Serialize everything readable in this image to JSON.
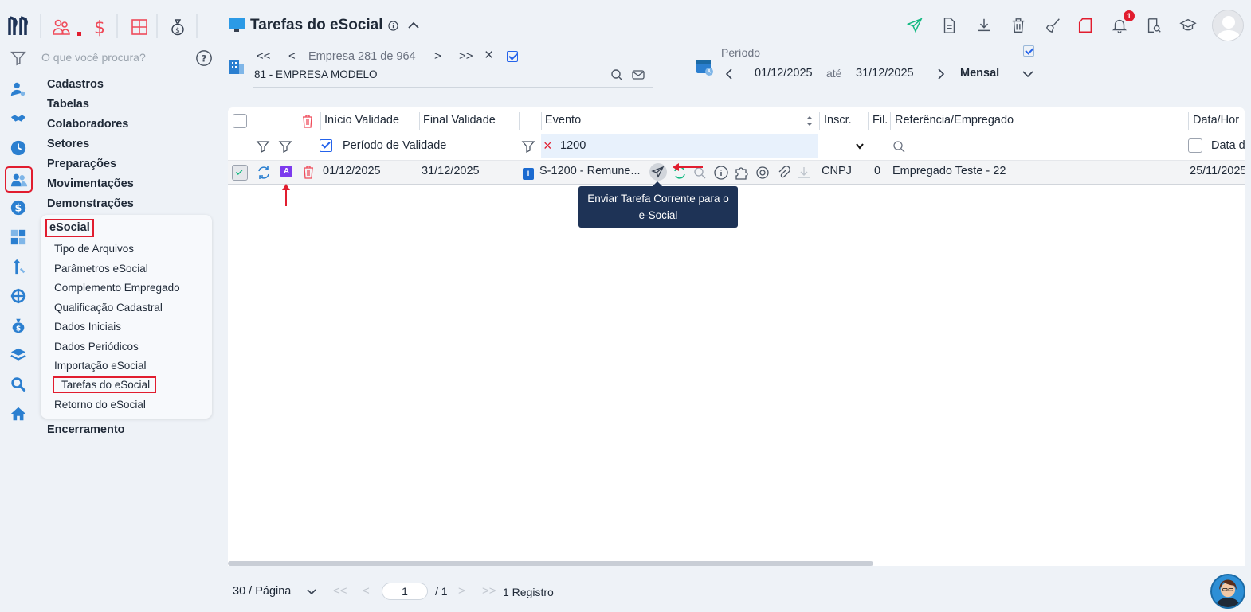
{
  "search": {
    "placeholder": "O que você procura?"
  },
  "menu": {
    "items": [
      "Cadastros",
      "Tabelas",
      "Colaboradores",
      "Setores",
      "Preparações",
      "Movimentações",
      "Demonstrações"
    ],
    "section": "eSocial",
    "subitems": [
      "Tipo de Arquivos",
      "Parâmetros eSocial",
      "Complemento Empregado",
      "Qualificação Cadastral",
      "Dados Iniciais",
      "Dados Periódicos",
      "Importação eSocial",
      "Tarefas do eSocial",
      "Retorno do eSocial"
    ],
    "last": "Encerramento"
  },
  "header": {
    "title": "Tarefas do eSocial",
    "notifications": "1"
  },
  "company": {
    "first": "<<",
    "prev": "<",
    "position": "Empresa 281 de 964",
    "next": ">",
    "last": ">>",
    "clear": "×",
    "name": "81 - EMPRESA MODELO"
  },
  "period": {
    "label": "Período",
    "start": "01/12/2025",
    "separator": "até",
    "end": "31/12/2025",
    "mode": "Mensal"
  },
  "grid": {
    "headers": {
      "inicio": "Início Validade",
      "final": "Final Validade",
      "evento": "Evento",
      "inscr": "Inscr.",
      "fil": "Fil.",
      "ref": "Referência/Empregado",
      "data": "Data/Hor"
    },
    "filters": {
      "periodo": "Período de Validade",
      "evento": "1200",
      "data": "Data d"
    },
    "row": {
      "badge": "A",
      "inicio": "01/12/2025",
      "final": "31/12/2025",
      "evento_tag": "I",
      "evento": "S-1200 - Remune...",
      "inscr": "CNPJ",
      "fil": "0",
      "ref": "Empregado Teste - 22",
      "data": "25/11/2025"
    }
  },
  "tooltip": {
    "line1": "Enviar Tarefa Corrente para o",
    "line2": "e-Social"
  },
  "pager": {
    "per_page": "30 / Página",
    "page": "1",
    "total": "/ 1",
    "records": "1 Registro"
  },
  "colors": {
    "accent": "#2563eb",
    "danger": "#e11d2f",
    "tooltip": "#1e3356",
    "send": "#10b981"
  }
}
